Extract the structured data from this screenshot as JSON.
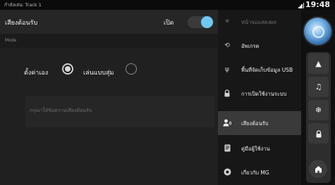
{
  "status": {
    "now_playing": "กำลังเล่น: Track 1",
    "time": "19:48"
  },
  "panel": {
    "title": "เสียงต้อนรับ",
    "toggle_label": "เปิด",
    "toggle_on": true,
    "mode_label": "Mode",
    "options": [
      {
        "label": "ตั้งค่าเอง",
        "selected": true
      },
      {
        "label": "เล่นแบบสุ่ม",
        "selected": false
      }
    ],
    "input_placeholder": "กรุณาใส่ข้อความเสียงต้อนรับ"
  },
  "menu": {
    "items": [
      {
        "label": "หน้าจอแสดงผล",
        "icon": "brightness-icon",
        "dimmed": true
      },
      {
        "label": "อัพเกรด",
        "icon": "upgrade-icon"
      },
      {
        "label": "พื้นที่จัดเก็บข้อมูล USB",
        "icon": "usb-icon"
      },
      {
        "label": "การเปิดใช้งานระบบ",
        "icon": "lock-icon"
      },
      {
        "label": "เสียงต้อนรับ",
        "icon": "welcome-voice-icon",
        "active": true
      },
      {
        "label": "คู่มือผู้ใช้งาน",
        "icon": "manual-icon"
      },
      {
        "label": "เกี่ยวกับ MG",
        "icon": "info-icon"
      }
    ]
  },
  "rail": {
    "buttons": [
      "navigation-icon",
      "music-icon",
      "fan-icon",
      "car-lock-icon"
    ],
    "home": "home-icon",
    "avatar": "assistant-avatar-icon"
  },
  "colors": {
    "accent": "#6fc8f2",
    "panel_bg": "#202020",
    "menu_active": "#3a3a3a"
  }
}
